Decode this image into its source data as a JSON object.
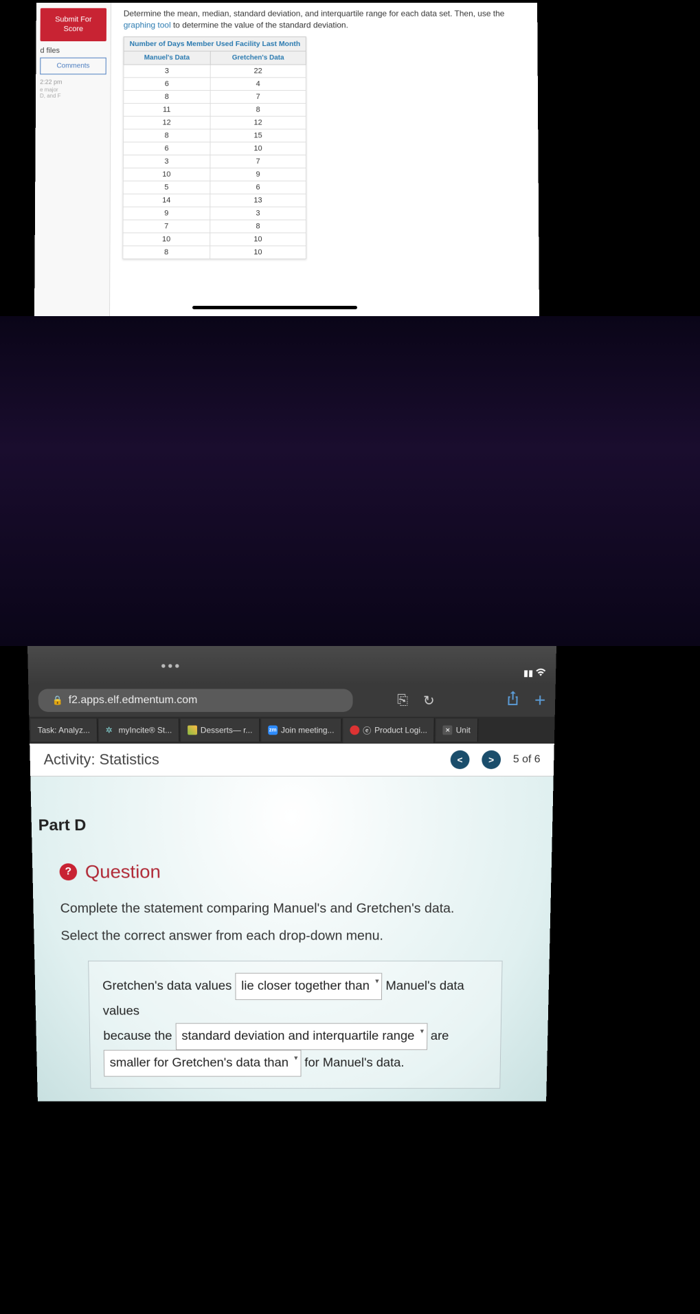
{
  "upper": {
    "submit_label": "Submit For Score",
    "d_files": "d files",
    "comments": "Comments",
    "time": "2:22 pm",
    "minor1": "e major",
    "minor2": "D, and F",
    "instruction_pre": "Determine the mean, median, standard deviation, and interquartile range for each data set. Then, use the ",
    "instruction_link": "graphing tool",
    "instruction_post": " to determine the value of the standard deviation.",
    "table_title": "Number of Days Member Used Facility Last Month",
    "col1": "Manuel's Data",
    "col2": "Gretchen's Data",
    "rows": [
      {
        "m": "3",
        "g": "22"
      },
      {
        "m": "6",
        "g": "4"
      },
      {
        "m": "8",
        "g": "7"
      },
      {
        "m": "11",
        "g": "8"
      },
      {
        "m": "12",
        "g": "12"
      },
      {
        "m": "8",
        "g": "15"
      },
      {
        "m": "6",
        "g": "10"
      },
      {
        "m": "3",
        "g": "7"
      },
      {
        "m": "10",
        "g": "9"
      },
      {
        "m": "5",
        "g": "6"
      },
      {
        "m": "14",
        "g": "13"
      },
      {
        "m": "9",
        "g": "3"
      },
      {
        "m": "7",
        "g": "8"
      },
      {
        "m": "10",
        "g": "10"
      },
      {
        "m": "8",
        "g": "10"
      }
    ]
  },
  "ipad": {
    "url": "f2.apps.elf.edmentum.com",
    "tabs": [
      {
        "label": "Task: Analyz..."
      },
      {
        "label": "myIncite® St..."
      },
      {
        "label": "Desserts— r..."
      },
      {
        "label": "Join meeting..."
      },
      {
        "label": "Product Logi..."
      },
      {
        "label": "Unit"
      }
    ],
    "activity": "Activity: Statistics",
    "page_pos": "5 of 6",
    "part": "Part D",
    "question_label": "Question",
    "q_line1": "Complete the statement comparing Manuel's and Gretchen's data.",
    "q_line2": "Select the correct answer from each drop-down menu.",
    "ans_pre1": "Gretchen's data values ",
    "dd1": "lie closer together than",
    "ans_post1": " Manuel's data values",
    "ans_pre2": "because the ",
    "dd2": "standard deviation and interquartile range",
    "ans_post2": " are",
    "dd3": "smaller for Gretchen's data than",
    "ans_post3": " for Manuel's data."
  }
}
